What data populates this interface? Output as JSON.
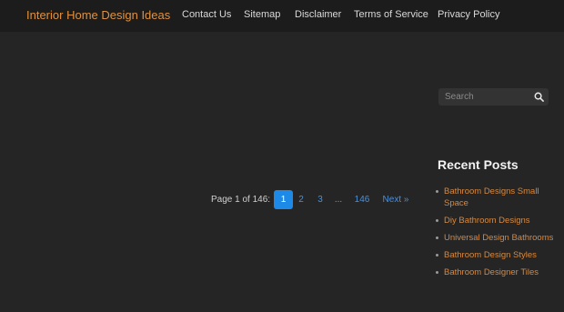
{
  "header": {
    "brand": "Interior Home Design Ideas",
    "nav": [
      "Contact Us",
      "Sitemap",
      "Disclaimer",
      "Terms of Service",
      "Privacy Policy"
    ]
  },
  "search": {
    "placeholder": "Search",
    "icon": "search-icon"
  },
  "sidebar": {
    "title": "Recent Posts",
    "posts": [
      "Bathroom Designs Small Space",
      "Diy Bathroom Designs",
      "Universal Design Bathrooms",
      "Bathroom Design Styles",
      "Bathroom Designer Tiles"
    ]
  },
  "pagination": {
    "label": "Page 1 of 146:",
    "pages": [
      "1",
      "2",
      "3"
    ],
    "ellipsis": "...",
    "last": "146",
    "next": "Next »",
    "current": "1"
  },
  "colors": {
    "background": "#252525",
    "header_bg": "#1c1c1c",
    "brand": "#e0913d",
    "link": "#d9883d",
    "active_page": "#1d8ae8"
  }
}
